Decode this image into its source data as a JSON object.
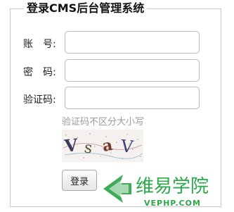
{
  "form": {
    "title": "登录CMS后台管理系统",
    "account_label": "账　号:",
    "password_label": "密　码:",
    "captcha_label": "验证码:",
    "account_value": "",
    "password_value": "",
    "captcha_value": "",
    "captcha_hint": "验证码不区分大小写",
    "captcha_image_text": "VsaV",
    "login_button": "登录"
  },
  "watermark": {
    "brand_name": "维易学院",
    "brand_url": "VEPHP.COM",
    "color": "#2aa84a"
  }
}
